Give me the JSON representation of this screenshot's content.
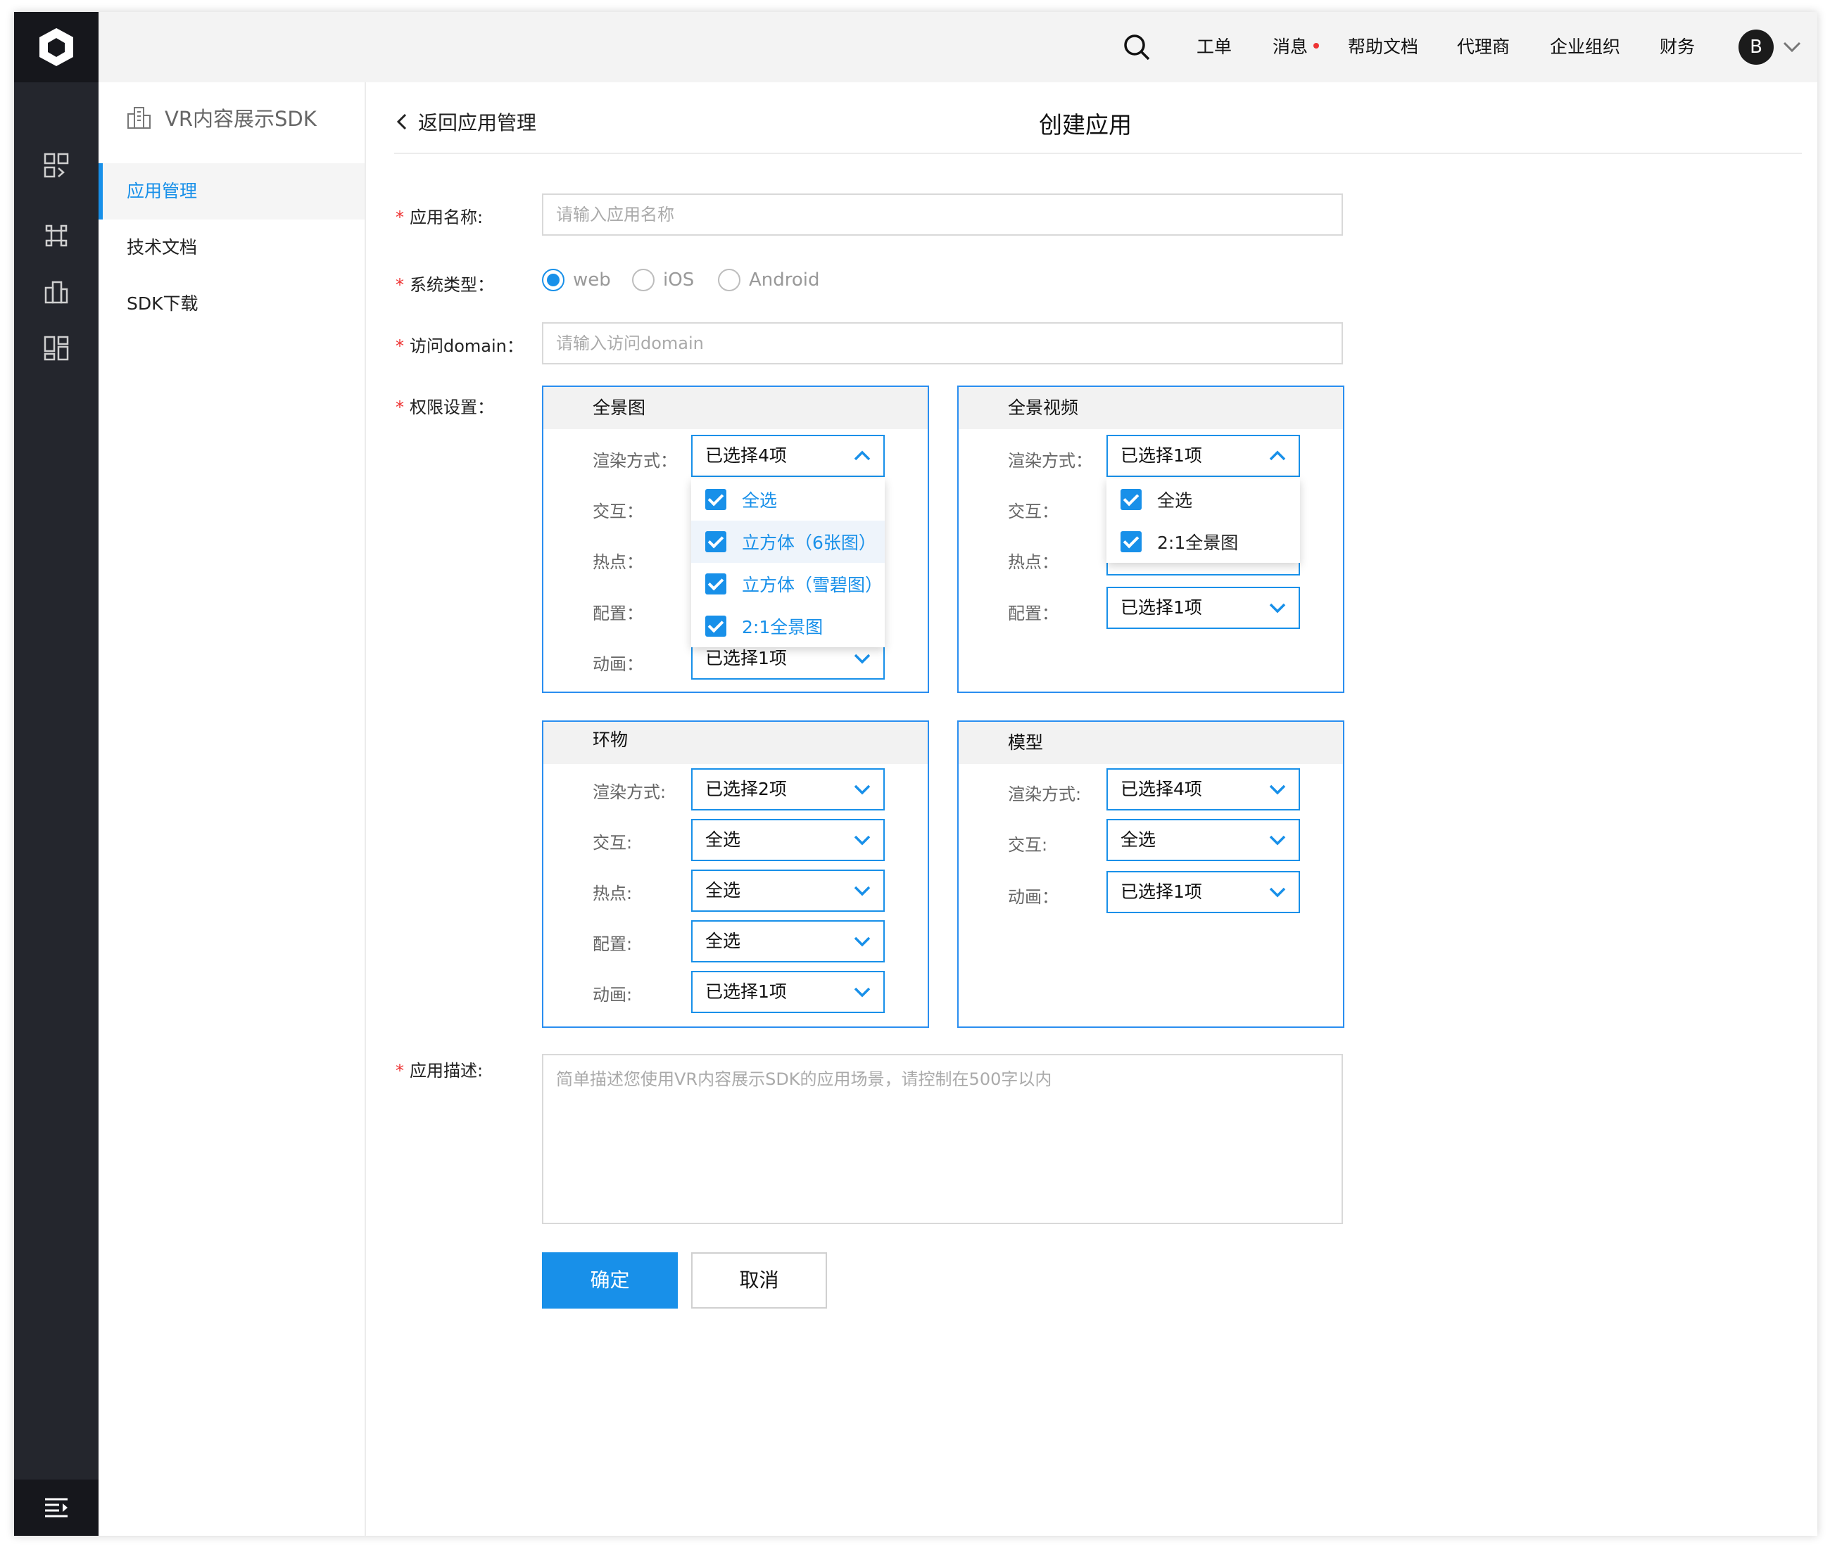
{
  "topbar": {
    "items": [
      "工单",
      "消息",
      "帮助文档",
      "代理商",
      "企业组织",
      "财务"
    ],
    "avatar": "B"
  },
  "sidebar": {
    "title": "VR内容展示SDK",
    "items": [
      "应用管理",
      "技术文档",
      "SDK下载"
    ],
    "active": 0
  },
  "page": {
    "back": "返回应用管理",
    "title": "创建应用"
  },
  "form": {
    "name_label": "应用名称:",
    "name_placeholder": "请输入应用名称",
    "os_label": "系统类型：",
    "os_options": [
      "web",
      "iOS",
      "Android"
    ],
    "os_selected": "web",
    "domain_label": "访问domain：",
    "domain_placeholder": "请输入访问domain",
    "perm_label": "权限设置：",
    "desc_label": "应用描述:",
    "desc_placeholder": "简单描述您使用VR内容展示SDK的应用场景，请控制在500字以内",
    "ok": "确定",
    "cancel": "取消"
  },
  "panels": {
    "pano": {
      "title": "全景图",
      "fields": [
        "渲染方式：",
        "交互：",
        "热点：",
        "配置：",
        "动画："
      ],
      "render": "已选择4项",
      "anim": "已选择1项",
      "dropdown": [
        "全选",
        "立方体（6张图）",
        "立方体（雪碧图）",
        "2:1全景图"
      ]
    },
    "video": {
      "title": "全景视频",
      "fields": [
        "渲染方式：",
        "交互：",
        "热点：",
        "配置："
      ],
      "render": "已选择1项",
      "config": "已选择1项",
      "dropdown": [
        "全选",
        "2:1全景图"
      ]
    },
    "ring": {
      "title": "环物",
      "fields": [
        "渲染方式:",
        "交互:",
        "热点:",
        "配置:",
        "动画:"
      ],
      "values": [
        "已选择2项",
        "全选",
        "全选",
        "全选",
        "已选择1项"
      ]
    },
    "model": {
      "title": "模型",
      "fields": [
        "渲染方式:",
        "交互:",
        "动画："
      ],
      "values": [
        "已选择4项",
        "全选",
        "已选择1项"
      ]
    }
  },
  "colors": {
    "accent": "#1890e9",
    "rail": "#24262d",
    "required": "#e33333"
  }
}
